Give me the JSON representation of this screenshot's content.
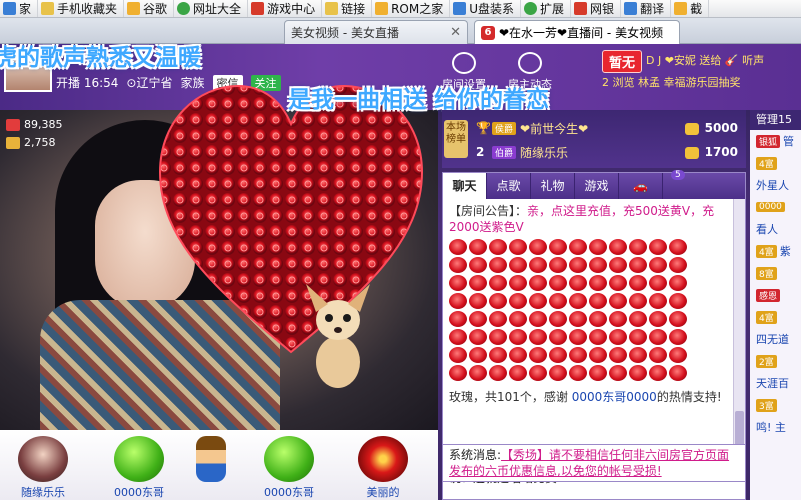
{
  "bookmarks": [
    {
      "label": "家",
      "icon": "home-icon"
    },
    {
      "label": "手机收藏夹",
      "icon": "folder-icon"
    },
    {
      "label": "谷歌",
      "icon": "google-icon"
    },
    {
      "label": "网址大全",
      "icon": "portal-icon"
    },
    {
      "label": "游戏中心",
      "icon": "game-icon"
    },
    {
      "label": "链接",
      "icon": "folder-icon"
    },
    {
      "label": "ROM之家",
      "icon": "rom-icon"
    },
    {
      "label": "U盘装系",
      "icon": "usb-icon"
    },
    {
      "label": "扩展",
      "icon": "extension-icon"
    },
    {
      "label": "网银",
      "icon": "bank-icon"
    },
    {
      "label": "翻译",
      "icon": "translate-icon"
    },
    {
      "label": "截",
      "icon": "screenshot-icon"
    }
  ],
  "tabs": [
    {
      "label": "美女视频 - 美女直播"
    },
    {
      "label": "❤在水一芳❤直播间 - 美女视频",
      "active": true
    }
  ],
  "lyrics": {
    "line1": "虎的歌声熟悉又温暖",
    "line2": "是我一曲相送 给你的眷恋"
  },
  "header": {
    "start_time": "开播 16:54",
    "location": "辽宁省",
    "family": "家族",
    "pm": "密信",
    "follow": "关注",
    "room_settings": "房间设置",
    "room_status": "房主动态",
    "temp_badge": "暂无",
    "marquee": "D J ❤安妮 送给 🎸 听声",
    "marquee2": "2  浏览  林孟 幸福游乐园抽奖"
  },
  "video": {
    "viewers": "89,385",
    "fans": "2,758"
  },
  "ranking": {
    "tag": "本场榜单",
    "rows": [
      {
        "rank": "1",
        "level": "侯爵",
        "name": "❤前世今生❤",
        "amount": "5000"
      },
      {
        "rank": "2",
        "level": "伯爵",
        "name": "随缘乐乐",
        "amount": "1700"
      }
    ]
  },
  "chat": {
    "tabs": [
      "聊天",
      "点歌",
      "礼物",
      "游戏"
    ],
    "car_count": "5",
    "notice_label": "【房间公告】：",
    "notice_text": "亲，点这里充值，充500送黄V，充2000送紫色V",
    "thanks_1": "玫瑰，共101个，感谢",
    "thanks_user": "0000东哥0000",
    "thanks_2": "的热情支持!",
    "say_text": "说：这就是唱站比赛"
  },
  "system": {
    "label": "系统消息:",
    "link_text": "【秀场】请不要相信任何非六间房官方页面发布的六币优惠信息,以免您的帐号受损!"
  },
  "gift_users": [
    {
      "name": "随缘乐乐"
    },
    {
      "name": "0000东哥"
    },
    {
      "name": ""
    },
    {
      "name": "0000东哥"
    },
    {
      "name": "美丽的"
    }
  ],
  "right_col": {
    "title": "管理15",
    "rows": [
      {
        "badge": "银狐",
        "text": "管"
      },
      {
        "badge": "4富",
        "text": ""
      },
      {
        "badge": "",
        "text": "外星人"
      },
      {
        "badge": "0000",
        "text": ""
      },
      {
        "badge": "",
        "text": "看人"
      },
      {
        "badge": "4富",
        "text": "紫"
      },
      {
        "badge": "8富",
        "text": ""
      },
      {
        "badge": "感恩",
        "text": ""
      },
      {
        "badge": "4富",
        "text": ""
      },
      {
        "badge": "",
        "text": "四无道"
      },
      {
        "badge": "2富",
        "text": ""
      },
      {
        "badge": "",
        "text": "天涯百"
      },
      {
        "badge": "3富",
        "text": ""
      },
      {
        "badge": "",
        "text": "鸣! 主"
      }
    ]
  },
  "colors": {
    "lyric": "#3ea8ff",
    "notice": "#d01c8b",
    "room_bg": "#4a2f78",
    "coin": "#f2c23a"
  }
}
